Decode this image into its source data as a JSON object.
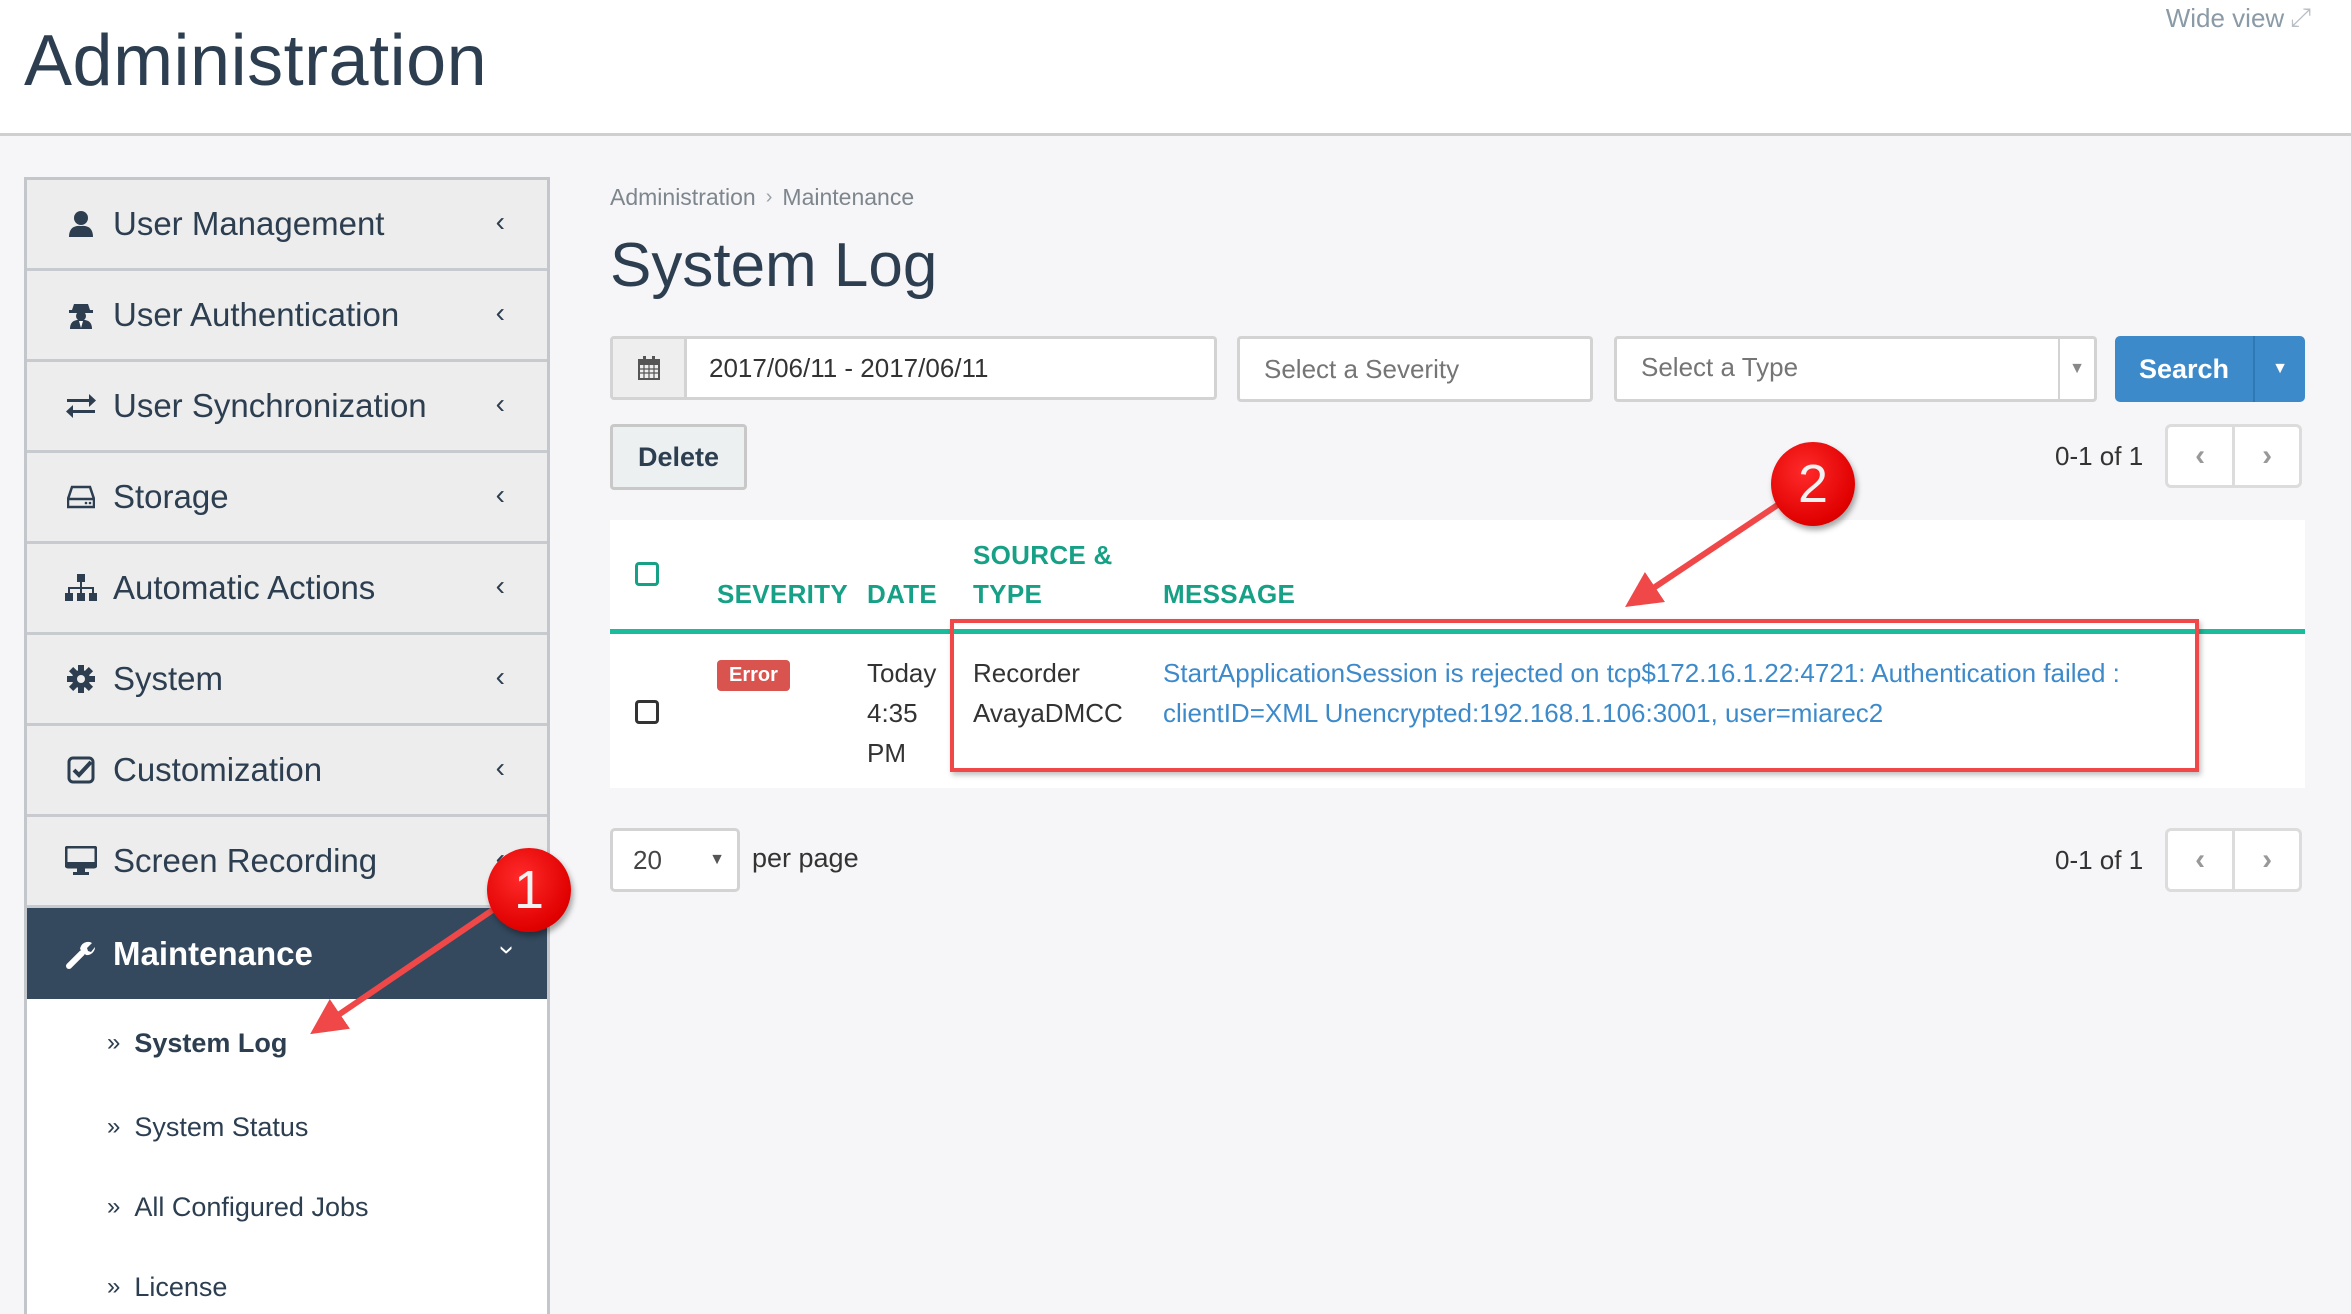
{
  "header": {
    "title": "Administration",
    "wide_view_label": "Wide view",
    "wide_view_icon": "expand-icon"
  },
  "sidebar": {
    "items": [
      {
        "label": "User Management",
        "icon": "user-icon",
        "expanded": false
      },
      {
        "label": "User Authentication",
        "icon": "user-secret-icon",
        "expanded": false
      },
      {
        "label": "User Synchronization",
        "icon": "exchange-icon",
        "expanded": false
      },
      {
        "label": "Storage",
        "icon": "hdd-icon",
        "expanded": false
      },
      {
        "label": "Automatic Actions",
        "icon": "sitemap-icon",
        "expanded": false
      },
      {
        "label": "System",
        "icon": "gear-icon",
        "expanded": false
      },
      {
        "label": "Customization",
        "icon": "check-square-icon",
        "expanded": false
      },
      {
        "label": "Screen Recording",
        "icon": "desktop-icon",
        "expanded": false
      },
      {
        "label": "Maintenance",
        "icon": "wrench-icon",
        "expanded": true,
        "active": true
      }
    ],
    "sub_items": [
      {
        "label": "System Log",
        "current": true
      },
      {
        "label": "System Status",
        "current": false
      },
      {
        "label": "All Configured Jobs",
        "current": false
      },
      {
        "label": "License",
        "current": false
      }
    ]
  },
  "breadcrumb": [
    "Administration",
    "Maintenance"
  ],
  "page_title": "System Log",
  "filters": {
    "date_range_value": "2017/06/11 - 2017/06/11",
    "severity_placeholder": "Select a Severity",
    "type_placeholder": "Select a Type",
    "search_label": "Search"
  },
  "actions": {
    "delete_label": "Delete"
  },
  "pagination": {
    "range_text": "0-1 of 1",
    "per_page_value": "20",
    "per_page_label": "per page"
  },
  "table": {
    "columns": {
      "severity": "SEVERITY",
      "date": "DATE",
      "source_line1": "SOURCE &",
      "source_line2": "TYPE",
      "message": "MESSAGE"
    },
    "rows": [
      {
        "severity": "Error",
        "date_line1": "Today",
        "date_line2": "4:35",
        "date_line3": "PM",
        "source": "Recorder",
        "type": "AvayaDMCC",
        "message_line1": "StartApplicationSession is rejected on tcp$172.16.1.22:4721: Authentication failed :",
        "message_line2": "clientID=XML Unencrypted:192.168.1.106:3001, user=miarec2"
      }
    ]
  },
  "annotations": {
    "marker1": "1",
    "marker2": "2"
  },
  "colors": {
    "primary_dark": "#34495e",
    "accent_teal": "#16a085",
    "table_rule": "#1abc9c",
    "search_blue": "#3d8acb",
    "error_red": "#d9534f",
    "annotation_red": "#f04848"
  }
}
